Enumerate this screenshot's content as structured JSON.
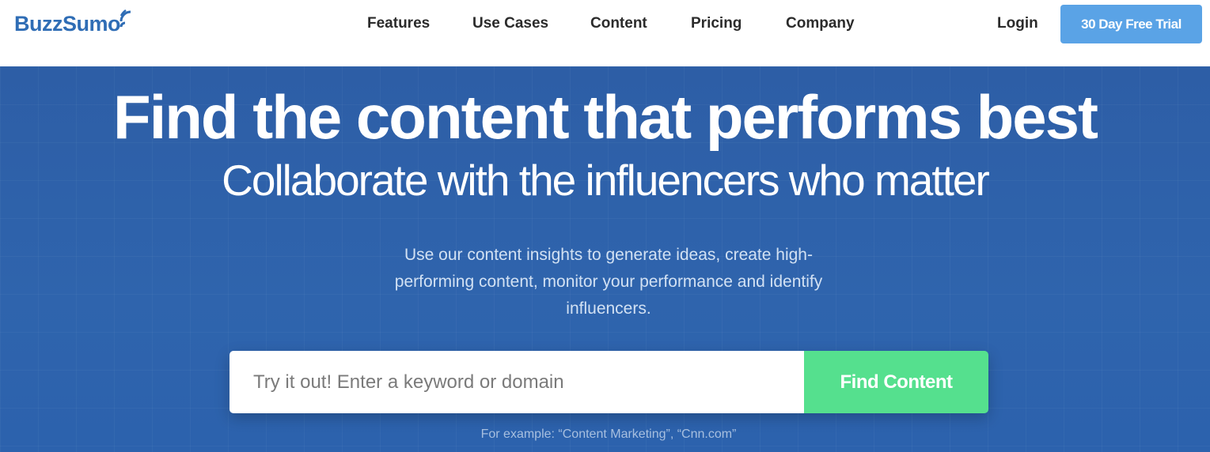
{
  "brand": {
    "name": "BuzzSumo",
    "color": "#2f6db5",
    "icon": "wifi-signal-icon"
  },
  "nav": {
    "items": [
      {
        "label": "Features"
      },
      {
        "label": "Use Cases"
      },
      {
        "label": "Content"
      },
      {
        "label": "Pricing"
      },
      {
        "label": "Company"
      }
    ],
    "login_label": "Login",
    "trial_label": "30 Day Free Trial"
  },
  "hero": {
    "headline": "Find the content that performs best",
    "subheadline": "Collaborate with the influencers who matter",
    "description": "Use our content insights to generate ideas, create high-performing content, monitor your performance and identify influencers.",
    "search": {
      "placeholder": "Try it out! Enter a keyword or domain",
      "value": "",
      "button_label": "Find Content"
    },
    "example": "For example: “Content Marketing”, “Cnn.com”"
  },
  "colors": {
    "hero_bg": "#2d5ea6",
    "trial_button": "#5aa3e6",
    "find_button": "#55e08e"
  }
}
